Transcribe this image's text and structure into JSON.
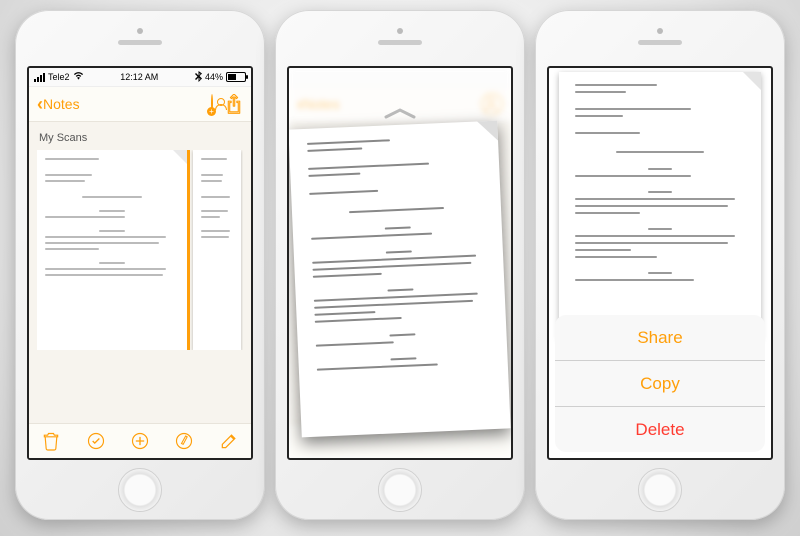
{
  "status": {
    "carrier": "Tele2",
    "time": "12:12 AM",
    "battery_pct": "44%"
  },
  "nav": {
    "back_label": "Notes"
  },
  "note": {
    "section_title": "My Scans"
  },
  "actionsheet": {
    "share": "Share",
    "copy": "Copy",
    "delete": "Delete"
  }
}
